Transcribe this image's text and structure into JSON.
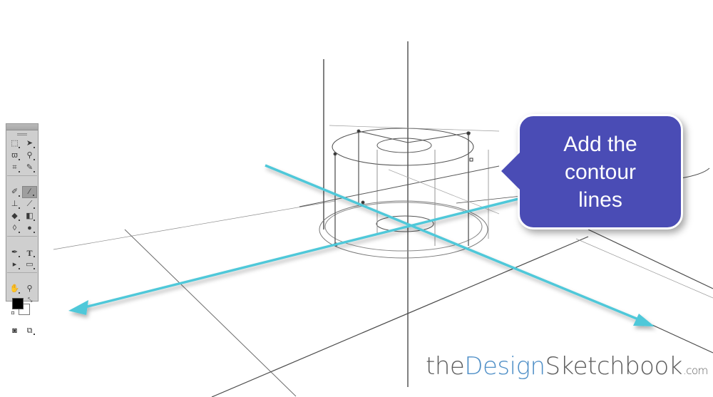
{
  "canvas": {
    "description": "Perspective sketch of a cylinder with construction lines",
    "annotation_color": "#4fc8d9",
    "sketch_line_color": "#3a3a3a"
  },
  "callout": {
    "text": "Add the\ncontour\nlines",
    "fill_color": "#4a4cb5",
    "text_color": "#ffffff"
  },
  "watermark": {
    "part1": "the",
    "part2": "Design",
    "part3": "Sketchbook",
    "part4": ".com",
    "accent_color": "#4f8fc7"
  },
  "toolpanel": {
    "tools": [
      {
        "name": "marquee-tool",
        "glyph": "⬚"
      },
      {
        "name": "move-tool",
        "glyph": "➤"
      },
      {
        "name": "lasso-tool",
        "glyph": "ϖ"
      },
      {
        "name": "quick-selection-tool",
        "glyph": "⚲"
      },
      {
        "name": "crop-tool",
        "glyph": "⌗"
      },
      {
        "name": "eyedropper-tool",
        "glyph": "✎"
      },
      {
        "name": "healing-brush-tool",
        "glyph": "✐"
      },
      {
        "name": "brush-tool",
        "glyph": "∕",
        "active": true
      },
      {
        "name": "clone-stamp-tool",
        "glyph": "⊥"
      },
      {
        "name": "history-brush-tool",
        "glyph": "⟋"
      },
      {
        "name": "eraser-tool",
        "glyph": "◆"
      },
      {
        "name": "gradient-tool",
        "glyph": "◧"
      },
      {
        "name": "blur-tool",
        "glyph": "◊"
      },
      {
        "name": "dodge-tool",
        "glyph": "●"
      },
      {
        "name": "pen-tool",
        "glyph": "✒"
      },
      {
        "name": "type-tool",
        "glyph": "T"
      },
      {
        "name": "path-selection-tool",
        "glyph": "▸"
      },
      {
        "name": "rectangle-tool",
        "glyph": "▭"
      },
      {
        "name": "hand-tool",
        "glyph": "✋"
      },
      {
        "name": "zoom-tool",
        "glyph": "⚲"
      }
    ],
    "foreground_color": "#000000",
    "background_color": "#ffffff",
    "swap_glyph": "⤡",
    "default_colors_glyph": "◘",
    "bottom": [
      {
        "name": "quick-mask-mode",
        "glyph": "◙"
      },
      {
        "name": "screen-mode",
        "glyph": "⧉"
      }
    ]
  }
}
